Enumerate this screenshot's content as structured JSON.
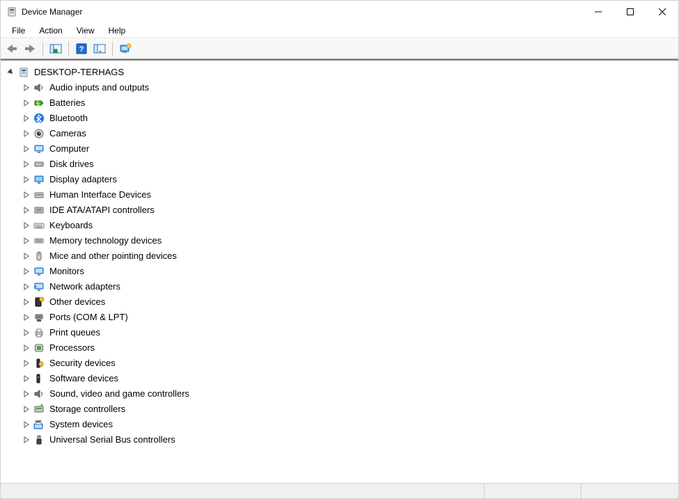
{
  "window": {
    "title": "Device Manager"
  },
  "menu": {
    "file": "File",
    "action": "Action",
    "view": "View",
    "help": "Help"
  },
  "toolbar": {
    "back": "back",
    "forward": "forward",
    "show_hide": "show-hide-console-tree",
    "help": "help",
    "properties": "properties",
    "scan": "scan-for-hardware-changes"
  },
  "tree": {
    "root": "DESKTOP-TERHAGS",
    "categories": [
      {
        "label": "Audio inputs and outputs",
        "icon": "speaker"
      },
      {
        "label": "Batteries",
        "icon": "battery"
      },
      {
        "label": "Bluetooth",
        "icon": "bluetooth"
      },
      {
        "label": "Cameras",
        "icon": "camera"
      },
      {
        "label": "Computer",
        "icon": "monitor"
      },
      {
        "label": "Disk drives",
        "icon": "disk"
      },
      {
        "label": "Display adapters",
        "icon": "display"
      },
      {
        "label": "Human Interface Devices",
        "icon": "hid"
      },
      {
        "label": "IDE ATA/ATAPI controllers",
        "icon": "ide"
      },
      {
        "label": "Keyboards",
        "icon": "keyboard"
      },
      {
        "label": "Memory technology devices",
        "icon": "memory"
      },
      {
        "label": "Mice and other pointing devices",
        "icon": "mouse"
      },
      {
        "label": "Monitors",
        "icon": "monitor"
      },
      {
        "label": "Network adapters",
        "icon": "network"
      },
      {
        "label": "Other devices",
        "icon": "other"
      },
      {
        "label": "Ports (COM & LPT)",
        "icon": "port"
      },
      {
        "label": "Print queues",
        "icon": "printer"
      },
      {
        "label": "Processors",
        "icon": "cpu"
      },
      {
        "label": "Security devices",
        "icon": "security"
      },
      {
        "label": "Software devices",
        "icon": "software"
      },
      {
        "label": "Sound, video and game controllers",
        "icon": "speaker"
      },
      {
        "label": "Storage controllers",
        "icon": "storage"
      },
      {
        "label": "System devices",
        "icon": "system"
      },
      {
        "label": "Universal Serial Bus controllers",
        "icon": "usb"
      }
    ]
  }
}
